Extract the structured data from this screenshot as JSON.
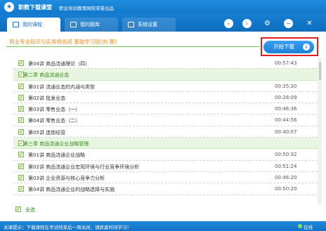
{
  "app": {
    "title": "职教下载课堂",
    "subtitle": "职业培训教育网校荣誉出品",
    "logo_glyph": "★"
  },
  "tabs": [
    {
      "label": "我的课程",
      "active": true
    },
    {
      "label": "我的题库",
      "active": false
    },
    {
      "label": "系统设置",
      "active": false
    }
  ],
  "toolbar": {
    "back": "‹",
    "forward": "›",
    "settings": "⚙",
    "minimize": "−",
    "close": "✕"
  },
  "course": {
    "title": "商业专业知识与实务特色班  基础学习班(刘    黧)"
  },
  "download": {
    "label": "开始下载",
    "arrow": "⇓"
  },
  "list": {
    "check": "✓",
    "rows": [
      {
        "type": "lesson",
        "name": "第04讲   商品流通理论（四）",
        "duration": "00:57:43"
      },
      {
        "type": "chapter",
        "name": "第二章   商品流通业态"
      },
      {
        "type": "lesson",
        "name": "第01讲   流通业态的内涵与类型",
        "duration": "00:35:30"
      },
      {
        "type": "lesson",
        "name": "第02讲   批发业态",
        "duration": "00:28:09"
      },
      {
        "type": "lesson",
        "name": "第03讲   零售业态（一）",
        "duration": "00:46:36"
      },
      {
        "type": "lesson",
        "name": "第04讲   零售业态（二）",
        "duration": "00:44:56"
      },
      {
        "type": "lesson",
        "name": "第05讲   连锁经营",
        "duration": "00:40:07"
      },
      {
        "type": "chapter",
        "name": "第三章   商品流通企业战略管理"
      },
      {
        "type": "lesson",
        "name": "第01讲   商品流通企业战略",
        "duration": "00:50:32"
      },
      {
        "type": "lesson",
        "name": "第02讲   商品流通企业宏观环境与行业竞争环境分析",
        "duration": "00:51:24"
      },
      {
        "type": "lesson",
        "name": "第03讲   企业资源与核心竞争力分析",
        "duration": "00:46:20"
      },
      {
        "type": "lesson",
        "name": "第04讲   商品流通企业的战略选择与实施",
        "duration": "00:50:20"
      }
    ]
  },
  "select_all": "全选",
  "status": {
    "text": "关课提示：下载课程在考试结束后一周关闭，请抓紧时间学习！",
    "online": "在线"
  },
  "colors": {
    "brand_blue": "#1a80d4",
    "chapter_green": "#3a8d1a",
    "title_orange": "#e88a1a",
    "highlight_red": "#e02020"
  }
}
